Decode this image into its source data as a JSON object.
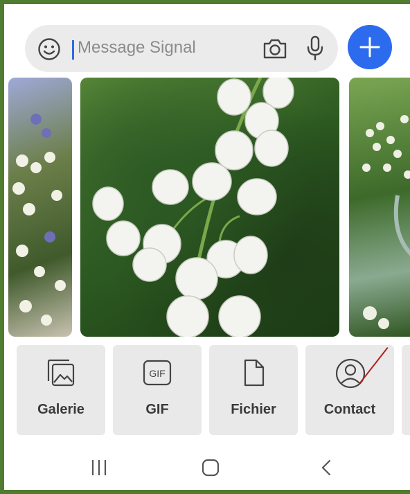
{
  "composer": {
    "placeholder": "Message Signal",
    "icons": [
      "emoji-icon",
      "camera-icon",
      "microphone-icon",
      "plus-icon"
    ]
  },
  "gallery": {
    "photos": [
      "photo-left",
      "photo-lily-of-the-valley",
      "photo-right"
    ]
  },
  "attachments": {
    "items": [
      {
        "label": "Galerie",
        "icon": "gallery-icon"
      },
      {
        "label": "GIF",
        "icon": "gif-icon",
        "icon_text": "GIF"
      },
      {
        "label": "Fichier",
        "icon": "file-icon"
      },
      {
        "label": "Contact",
        "icon": "contact-icon"
      }
    ]
  },
  "navbar": {
    "icons": [
      "recent-apps-icon",
      "home-icon",
      "back-icon"
    ]
  },
  "colors": {
    "frame": "#4f7c2f",
    "accent": "#2c6bed",
    "annotation": "#b02020"
  }
}
